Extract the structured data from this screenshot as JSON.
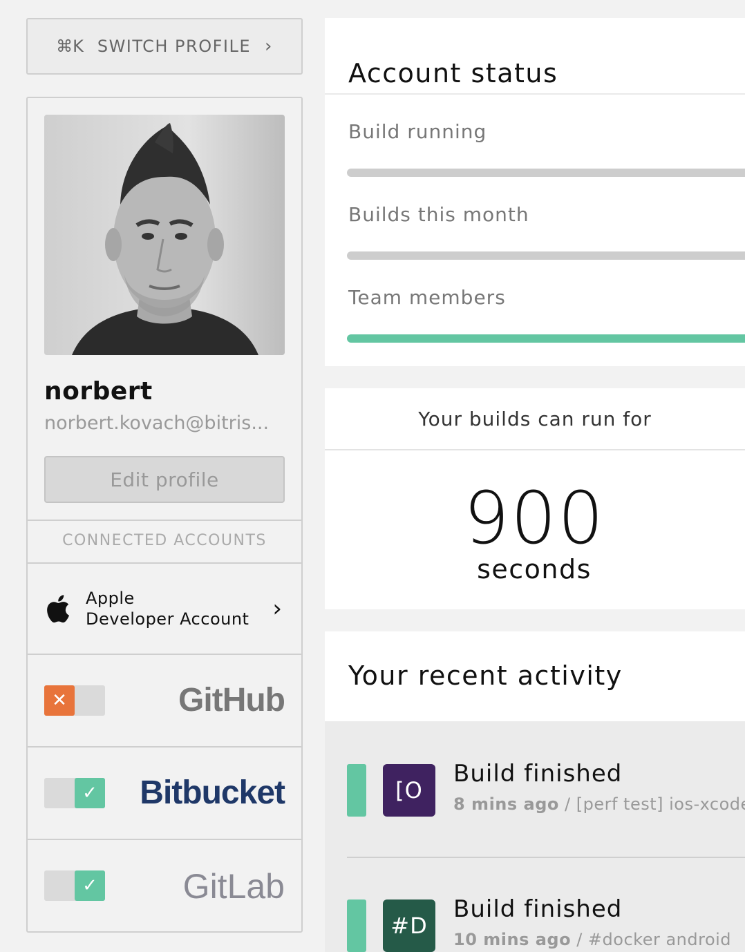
{
  "switch_profile": {
    "shortcut": "⌘K",
    "label": "SWITCH PROFILE",
    "chevron": "›"
  },
  "profile": {
    "avatar": "profile-photo",
    "username": "norbert",
    "email": "norbert.kovach@bitris...",
    "edit_label": "Edit profile"
  },
  "connected_accounts": {
    "heading": "CONNECTED ACCOUNTS",
    "apple": {
      "icon": "apple-logo-icon",
      "line1": "Apple",
      "line2": "Developer Account",
      "chevron": "›"
    },
    "services": [
      {
        "name": "GitHub",
        "connected": false,
        "knob_symbol": "✕",
        "logo_color": "#777777"
      },
      {
        "name": "Bitbucket",
        "connected": true,
        "knob_symbol": "✓",
        "logo_color": "#1f3868"
      },
      {
        "name": "GitLab",
        "connected": true,
        "knob_symbol": "✓",
        "logo_color": "#8a8a94"
      }
    ]
  },
  "account_status": {
    "title": "Account status",
    "metrics": [
      {
        "label": "Build running",
        "progress": 0
      },
      {
        "label": "Builds this month",
        "progress": 0
      },
      {
        "label": "Team members",
        "progress": 1
      }
    ],
    "accent": "#63c6a2"
  },
  "run_time": {
    "heading": "Your builds can run for",
    "value": "900",
    "unit": "seconds"
  },
  "recent_activity": {
    "title": "Your recent activity",
    "items": [
      {
        "badge": "[O",
        "badge_color": "#3f2260",
        "title": "Build finished",
        "time": "8 mins ago",
        "separator": " / ",
        "context": "[perf test] ios-xcode-"
      },
      {
        "badge": "#D",
        "badge_color": "#255a48",
        "title": "Build finished",
        "time": "10 mins ago",
        "separator": " / ",
        "context": "#docker android"
      }
    ]
  }
}
